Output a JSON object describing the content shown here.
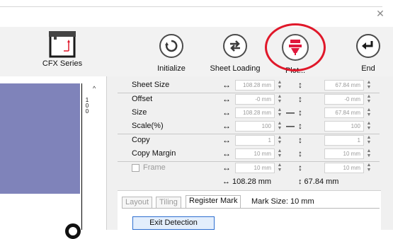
{
  "toolbar": {
    "logo_label": "CFX Series",
    "buttons": [
      {
        "label": "Initialize",
        "icon": "refresh-icon"
      },
      {
        "label": "Sheet Loading",
        "icon": "exchange-arrows-icon"
      },
      {
        "label": "Plot...",
        "icon": "plot-pen-icon"
      },
      {
        "label": "End",
        "icon": "return-arrow-icon"
      }
    ]
  },
  "ruler": {
    "label": "100"
  },
  "params": {
    "sheet_size": {
      "label": "Sheet Size",
      "w": "108.28 mm",
      "h": "67.84 mm"
    },
    "offset": {
      "label": "Offset",
      "x": "-0 mm",
      "y": "-0 mm"
    },
    "size": {
      "label": "Size",
      "w": "108.28 mm",
      "h": "67.84 mm"
    },
    "scale": {
      "label": "Scale(%)",
      "x": "100",
      "y": "100"
    },
    "copy": {
      "label": "Copy",
      "x": "1",
      "y": "1"
    },
    "copy_margin": {
      "label": "Copy Margin",
      "x": "10 mm",
      "y": "10 mm"
    },
    "frame": {
      "label": "Frame",
      "x": "10 mm",
      "y": "10 mm"
    },
    "totals": {
      "w": "↔ 108.28 mm",
      "h": "↕ 67.84 mm"
    }
  },
  "tabs": {
    "layout": "Layout",
    "tiling": "Tiling",
    "register_mark": "Register Mark"
  },
  "register": {
    "mark_size": "Mark Size:  10 mm",
    "exit_detection": "Exit Detection"
  },
  "colors": {
    "preview": "#7f83ba",
    "highlight_ring": "#e0182a",
    "plot_icon": "#e0183c"
  }
}
